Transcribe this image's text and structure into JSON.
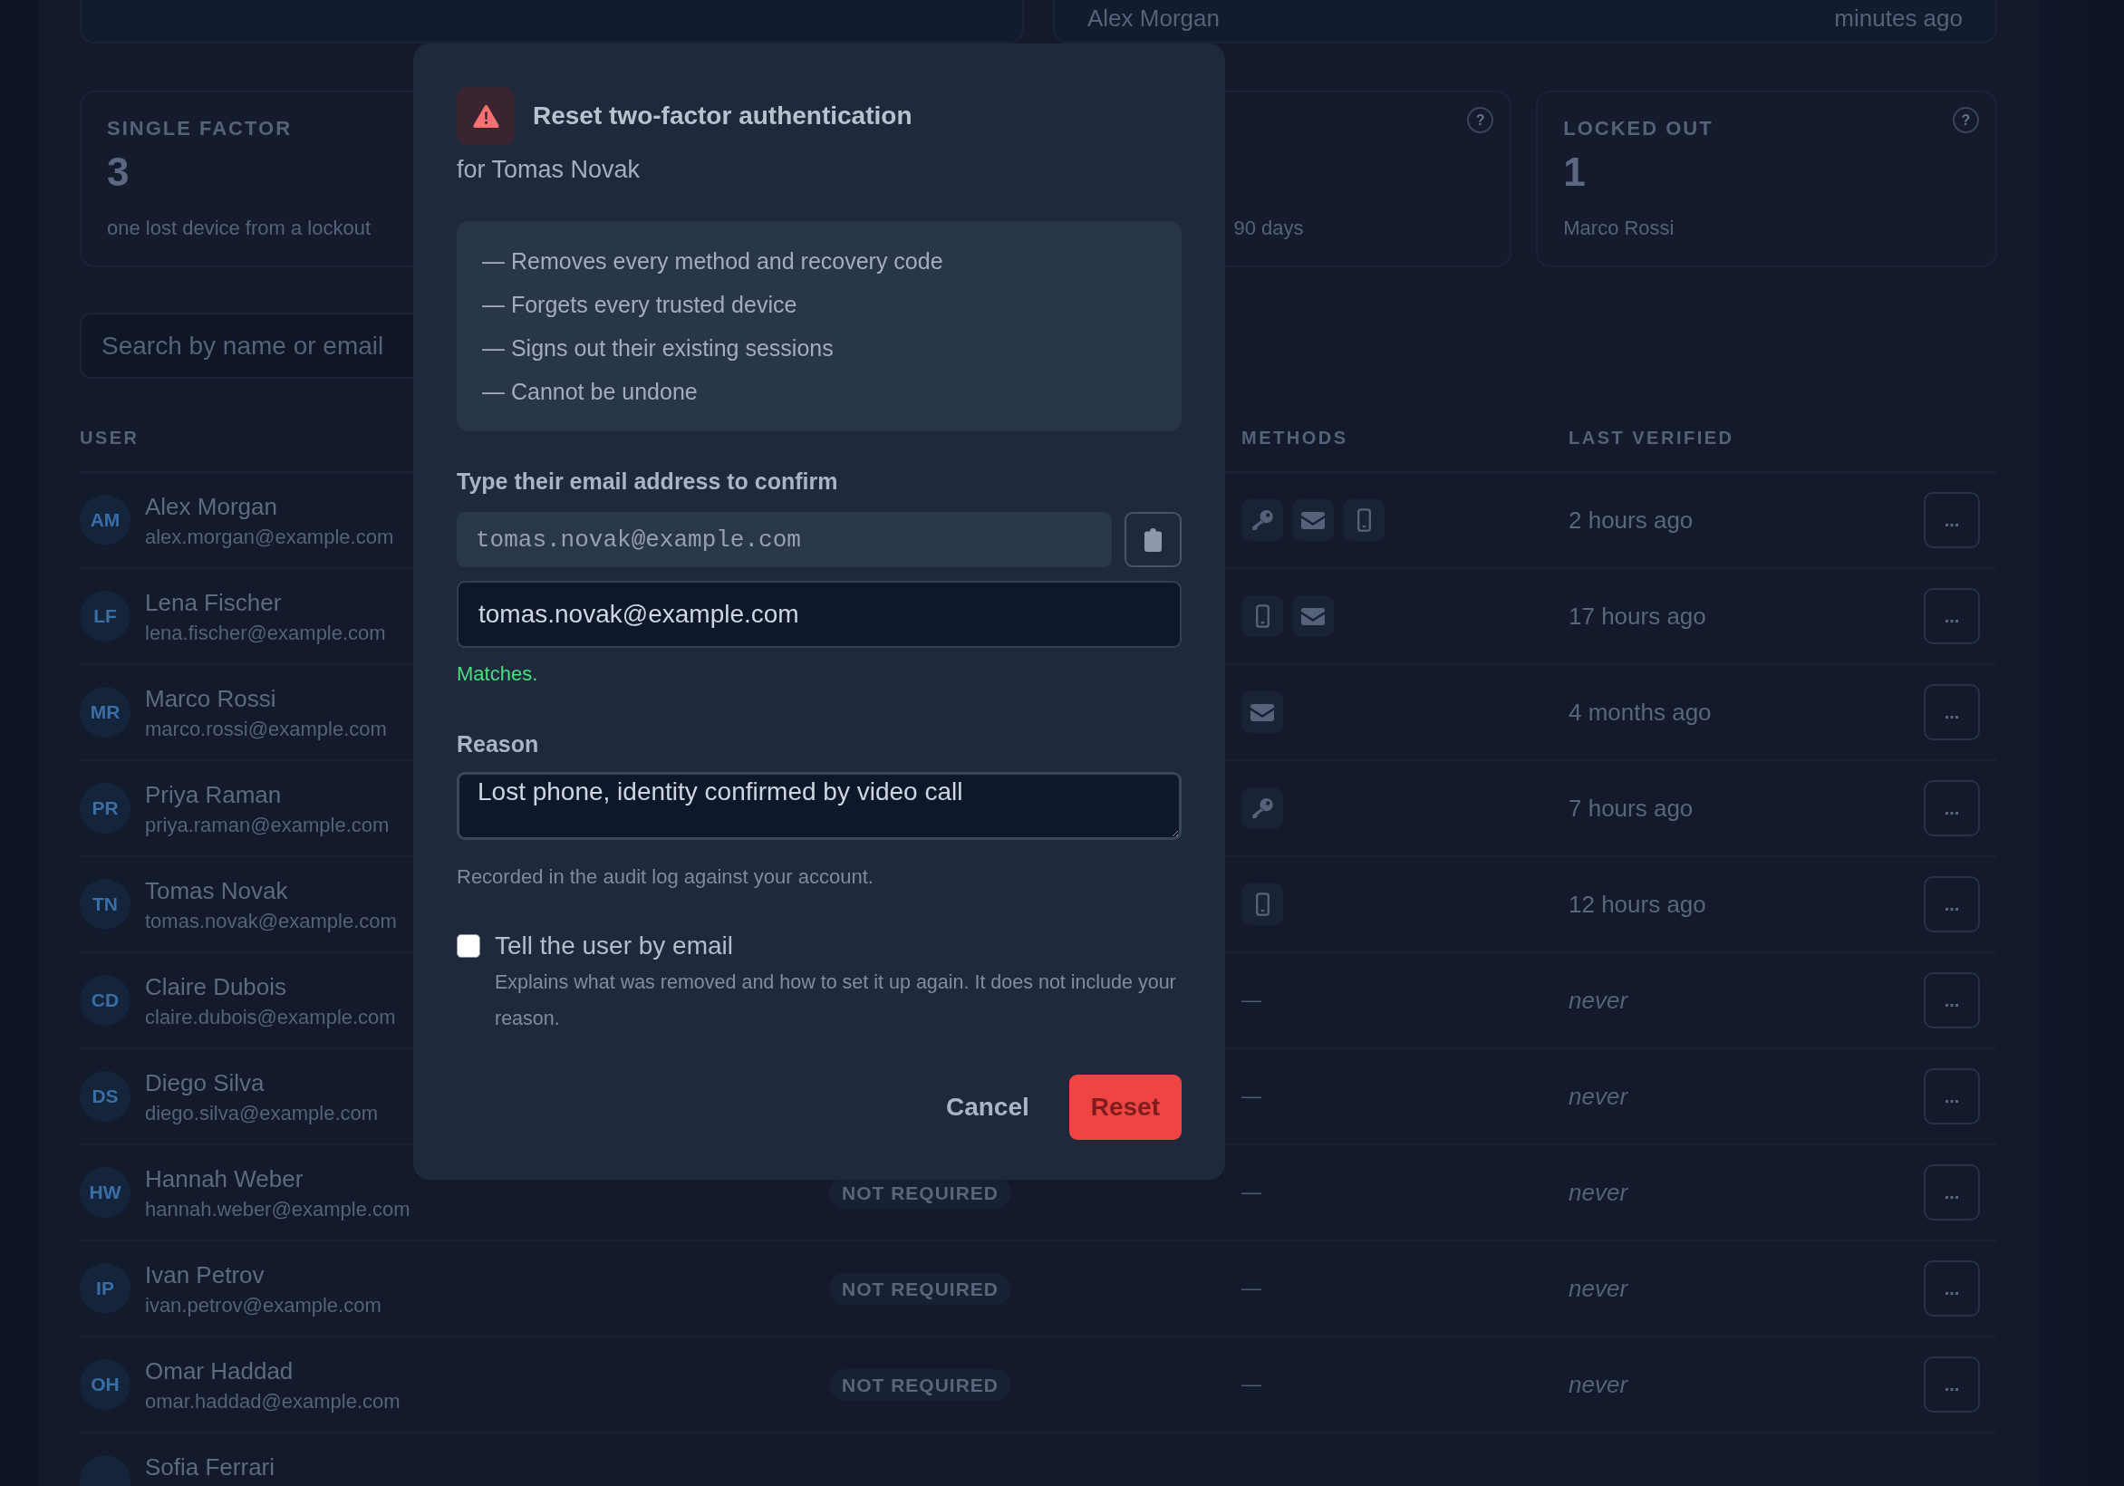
{
  "recent_card": {
    "name": "Alex Morgan",
    "time": "minutes ago"
  },
  "stat_cards": [
    {
      "kind": "full",
      "label": "SINGLE FACTOR",
      "value": "3",
      "note": "one lost device from a lockout"
    },
    {
      "kind": "tail",
      "note": "90 days",
      "help": "?"
    },
    {
      "kind": "full",
      "label": "LOCKED OUT",
      "value": "1",
      "note": "Marco Rossi",
      "help": "?"
    }
  ],
  "search": {
    "placeholder": "Search by name or email"
  },
  "table": {
    "columns": {
      "user": "USER",
      "methods": "METHODS",
      "last_verified": "LAST VERIFIED"
    },
    "rows": [
      {
        "initials": "AM",
        "name": "Alex Morgan",
        "email": "alex.morgan@example.com",
        "methods": [
          {
            "kind": "key"
          },
          {
            "kind": "email"
          },
          {
            "kind": "phone"
          }
        ],
        "last_verified": "2 hours ago",
        "verified": true,
        "action": "..."
      },
      {
        "initials": "LF",
        "name": "Lena Fischer",
        "email": "lena.fischer@example.com",
        "methods": [
          {
            "kind": "phone"
          },
          {
            "kind": "email"
          }
        ],
        "last_verified": "17 hours ago",
        "verified": true,
        "action": "..."
      },
      {
        "initials": "MR",
        "name": "Marco Rossi",
        "email": "marco.rossi@example.com",
        "methods": [
          {
            "kind": "email"
          }
        ],
        "last_verified": "4 months ago",
        "verified": true,
        "action": "..."
      },
      {
        "initials": "PR",
        "name": "Priya Raman",
        "email": "priya.raman@example.com",
        "methods": [
          {
            "kind": "key"
          }
        ],
        "last_verified": "7 hours ago",
        "verified": true,
        "action": "..."
      },
      {
        "initials": "TN",
        "name": "Tomas Novak",
        "email": "tomas.novak@example.com",
        "methods": [
          {
            "kind": "phone"
          }
        ],
        "last_verified": "12 hours ago",
        "verified": true,
        "action": "..."
      },
      {
        "initials": "CD",
        "name": "Claire Dubois",
        "email": "claire.dubois@example.com",
        "methods_text": "—",
        "last_verified": "never",
        "verified": false,
        "action": "..."
      },
      {
        "initials": "DS",
        "name": "Diego Silva",
        "email": "diego.silva@example.com",
        "methods_text": "—",
        "last_verified": "never",
        "verified": false,
        "action": "..."
      },
      {
        "initials": "HW",
        "name": "Hannah Weber",
        "email": "hannah.weber@example.com",
        "status": "NOT REQUIRED",
        "methods_text": "—",
        "last_verified": "never",
        "verified": false,
        "action": "..."
      },
      {
        "initials": "IP",
        "name": "Ivan Petrov",
        "email": "ivan.petrov@example.com",
        "status": "NOT REQUIRED",
        "methods_text": "—",
        "last_verified": "never",
        "verified": false,
        "action": "..."
      },
      {
        "initials": "OH",
        "name": "Omar Haddad",
        "email": "omar.haddad@example.com",
        "status": "NOT REQUIRED",
        "methods_text": "—",
        "last_verified": "never",
        "verified": false,
        "action": "..."
      },
      {
        "name": "Sofia Ferrari"
      }
    ]
  },
  "dialog": {
    "title": "Reset two-factor authentication",
    "subtitle": "for Tomas Novak",
    "consequences": [
      "— Removes every method and recovery code",
      "— Forgets every trusted device",
      "— Signs out their existing sessions",
      "— Cannot be undone"
    ],
    "confirm_label": "Type their email address to confirm",
    "expected_email": "tomas.novak@example.com",
    "email_input": {
      "value": "tomas.novak@example.com"
    },
    "match_message": "Matches.",
    "email_matches": true,
    "reason_label": "Reason",
    "reason_input": {
      "value": "Lost phone, identity confirmed by video call"
    },
    "reason_help": "Recorded in the audit log against your account.",
    "notify": {
      "label": "Tell the user by email",
      "checked": false,
      "description": "Explains what was removed and how to set it up again. It does not include your reason."
    },
    "buttons": [
      {
        "kind": "secondary",
        "label": "Cancel"
      },
      {
        "kind": "danger",
        "label": "Reset"
      }
    ]
  }
}
